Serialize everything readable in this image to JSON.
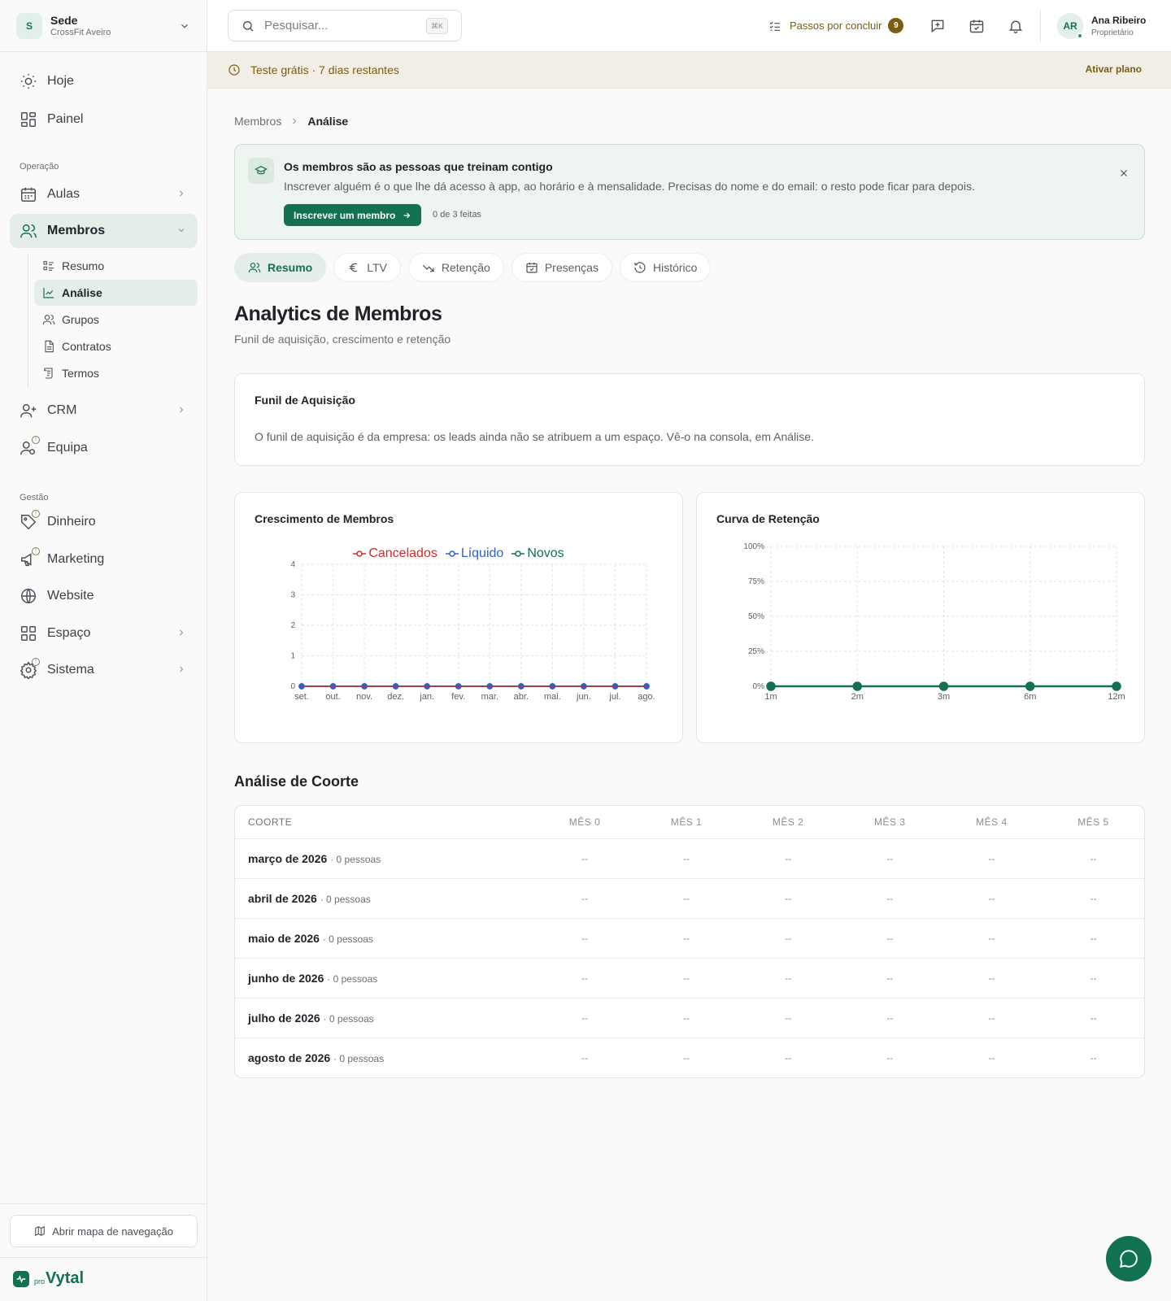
{
  "workspace": {
    "initial": "S",
    "name": "Sede",
    "sub": "CrossFit Aveiro"
  },
  "sidebar": {
    "hoje": "Hoje",
    "painel": "Painel",
    "operacao": "Operação",
    "aulas": "Aulas",
    "membros": "Membros",
    "membros_sub": [
      "Resumo",
      "Análise",
      "Grupos",
      "Contratos",
      "Termos"
    ],
    "crm": "CRM",
    "equipa": "Equipa",
    "gestao": "Gestão",
    "dinheiro": "Dinheiro",
    "marketing": "Marketing",
    "website": "Website",
    "espaco": "Espaço",
    "sistema": "Sistema",
    "map_button": "Abrir mapa de navegação",
    "logo_pro": "pro",
    "logo_name": "Vytal"
  },
  "topbar": {
    "search_placeholder": "Pesquisar...",
    "search_kbd": "⌘K",
    "steps_label": "Passos por concluir",
    "steps_count": "9",
    "user_initials": "AR",
    "user_name": "Ana Ribeiro",
    "user_role": "Proprietário"
  },
  "trial": {
    "text": "Teste grátis · 7 dias restantes",
    "action": "Ativar plano"
  },
  "breadcrumb": {
    "parent": "Membros",
    "current": "Análise"
  },
  "banner": {
    "title": "Os membros são as pessoas que treinam contigo",
    "text": "Inscrever alguém é o que lhe dá acesso à app, ao horário e à mensalidade. Precisas do nome e do email: o resto pode ficar para depois.",
    "button": "Inscrever um membro",
    "progress": "0 de 3 feitas"
  },
  "tabs": [
    "Resumo",
    "LTV",
    "Retenção",
    "Presenças",
    "Histórico"
  ],
  "page": {
    "title": "Analytics de Membros",
    "subtitle": "Funil de aquisição, crescimento e retenção"
  },
  "funil": {
    "title": "Funil de Aquisição",
    "text": "O funil de aquisição é da empresa: os leads ainda não se atribuem a um espaço. Vê-o na consola, em Análise."
  },
  "chart_data": [
    {
      "type": "line",
      "title": "Crescimento de Membros",
      "categories": [
        "set.",
        "out.",
        "nov.",
        "dez.",
        "jan.",
        "fev.",
        "mar.",
        "abr.",
        "mai.",
        "jun.",
        "jul.",
        "ago."
      ],
      "ylim": [
        0,
        4
      ],
      "yticks": [
        "0",
        "1",
        "2",
        "3",
        "4"
      ],
      "grid": true,
      "legend": "top",
      "series": [
        {
          "name": "Cancelados",
          "color": "#d12b2b",
          "values": [
            0,
            0,
            0,
            0,
            0,
            0,
            0,
            0,
            0,
            0,
            0,
            0
          ]
        },
        {
          "name": "Líquido",
          "color": "#2b62d1",
          "values": [
            0,
            0,
            0,
            0,
            0,
            0,
            0,
            0,
            0,
            0,
            0,
            0
          ]
        },
        {
          "name": "Novos",
          "color": "#127150",
          "values": [
            0,
            0,
            0,
            0,
            0,
            0,
            0,
            0,
            0,
            0,
            0,
            0
          ]
        }
      ]
    },
    {
      "type": "line",
      "title": "Curva de Retenção",
      "categories": [
        "1m",
        "2m",
        "3m",
        "6m",
        "12m"
      ],
      "ylim": [
        0,
        100
      ],
      "yticks": [
        "0%",
        "25%",
        "50%",
        "75%",
        "100%"
      ],
      "grid": true,
      "series": [
        {
          "color": "#127150",
          "values": [
            0,
            0,
            0,
            0,
            0
          ]
        }
      ]
    }
  ],
  "coorte": {
    "title": "Análise de Coorte",
    "headers": [
      "COORTE",
      "MÊS 0",
      "MÊS 1",
      "MÊS 2",
      "MÊS 3",
      "MÊS 4",
      "MÊS 5"
    ],
    "rows": [
      {
        "label": "março de 2026",
        "people": "· 0 pessoas",
        "cells": [
          "--",
          "--",
          "--",
          "--",
          "--",
          "--"
        ]
      },
      {
        "label": "abril de 2026",
        "people": "· 0 pessoas",
        "cells": [
          "--",
          "--",
          "--",
          "--",
          "--",
          "--"
        ]
      },
      {
        "label": "maio de 2026",
        "people": "· 0 pessoas",
        "cells": [
          "--",
          "--",
          "--",
          "--",
          "--",
          "--"
        ]
      },
      {
        "label": "junho de 2026",
        "people": "· 0 pessoas",
        "cells": [
          "--",
          "--",
          "--",
          "--",
          "--",
          "--"
        ]
      },
      {
        "label": "julho de 2026",
        "people": "· 0 pessoas",
        "cells": [
          "--",
          "--",
          "--",
          "--",
          "--",
          "--"
        ]
      },
      {
        "label": "agosto de 2026",
        "people": "· 0 pessoas",
        "cells": [
          "--",
          "--",
          "--",
          "--",
          "--",
          "--"
        ]
      }
    ]
  }
}
